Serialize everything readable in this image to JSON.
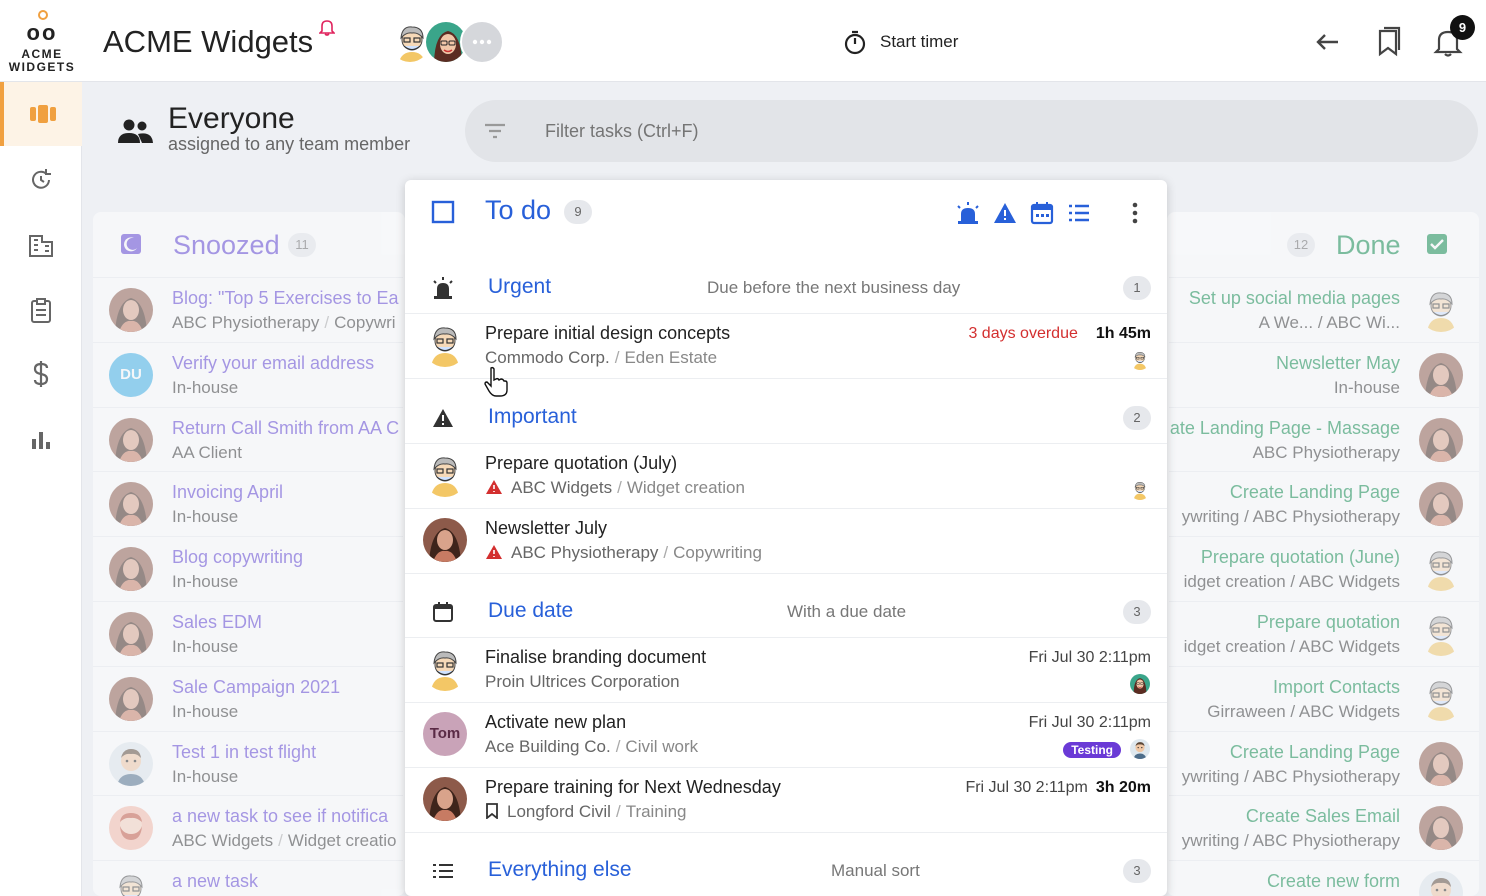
{
  "app": {
    "logo_text": "ACME WIDGETS",
    "title": "ACME Widgets"
  },
  "topbar": {
    "timer_label": "Start timer",
    "notification_count": "9"
  },
  "sidebar": {
    "items": [
      "board",
      "history",
      "clients",
      "tasks",
      "billing",
      "reports"
    ]
  },
  "header": {
    "title": "Everyone",
    "subtitle": "assigned to any team member"
  },
  "filter": {
    "placeholder": "Filter tasks (Ctrl+F)"
  },
  "snoozed": {
    "title": "Snoozed",
    "count": "11",
    "rows": [
      {
        "title": "Blog: \"Top 5 Exercises to Ea",
        "client": "ABC Physiotherapy",
        "project": "Copywri",
        "avatar": "woman-brown"
      },
      {
        "title": "Verify your email address",
        "client": "In-house",
        "project": "",
        "avatar": "DU"
      },
      {
        "title": "Return Call Smith from AA C",
        "client": "AA Client",
        "project": "",
        "avatar": "woman-brown"
      },
      {
        "title": "Invoicing April",
        "client": "In-house",
        "project": "",
        "avatar": "woman-brown"
      },
      {
        "title": "Blog copywriting",
        "client": "In-house",
        "project": "",
        "avatar": "woman-brown"
      },
      {
        "title": "Sales EDM",
        "client": "In-house",
        "project": "",
        "avatar": "woman-brown"
      },
      {
        "title": "Sale Campaign 2021",
        "client": "In-house",
        "project": "",
        "avatar": "woman-brown"
      },
      {
        "title": "Test 1 in test flight",
        "client": "In-house",
        "project": "",
        "avatar": "man-cartoon"
      },
      {
        "title": "a new task to see if notifica",
        "client": "ABC Widgets",
        "project": "Widget creatio",
        "avatar": "man-beard"
      },
      {
        "title": "a new task",
        "client": "",
        "project": "",
        "avatar": "woman-cartoon"
      }
    ]
  },
  "done": {
    "title": "Done",
    "count": "12",
    "rows": [
      {
        "title": "Set up social media pages",
        "sub": "A We...  /  ABC Wi...",
        "avatar": "woman-cartoon"
      },
      {
        "title": "Newsletter May",
        "sub": "In-house",
        "avatar": "woman-brown"
      },
      {
        "title": "ate Landing Page - Massage",
        "sub": "ABC Physiotherapy",
        "avatar": "woman-brown"
      },
      {
        "title": "Create Landing Page",
        "sub": "ywriting  /  ABC Physiotherapy",
        "avatar": "woman-brown"
      },
      {
        "title": "Prepare quotation (June)",
        "sub": "idget creation  /  ABC Widgets",
        "avatar": "woman-cartoon"
      },
      {
        "title": "Prepare quotation",
        "sub": "idget creation  /  ABC Widgets",
        "avatar": "woman-cartoon"
      },
      {
        "title": "Import Contacts",
        "sub": "Girraween  /  ABC Widgets",
        "avatar": "woman-cartoon"
      },
      {
        "title": "Create Landing Page",
        "sub": "ywriting  /  ABC Physiotherapy",
        "avatar": "woman-brown"
      },
      {
        "title": "Create Sales Email",
        "sub": "ywriting  /  ABC Physiotherapy",
        "avatar": "woman-brown"
      },
      {
        "title": "Create new form",
        "sub": "",
        "avatar": "man-cartoon"
      }
    ]
  },
  "todo": {
    "title": "To do",
    "count": "9",
    "sections": {
      "urgent": {
        "name": "Urgent",
        "desc": "Due before the next business day",
        "count": "1"
      },
      "important": {
        "name": "Important",
        "count": "2"
      },
      "due": {
        "name": "Due date",
        "desc": "With a due date",
        "count": "3"
      },
      "else": {
        "name": "Everything else",
        "desc": "Manual sort",
        "count": "3"
      }
    },
    "tasks": [
      {
        "title": "Prepare initial design concepts",
        "client": "Commodo Corp.",
        "project": "Eden Estate",
        "overdue": "3 days overdue",
        "duration": "1h 45m"
      },
      {
        "title": "Prepare quotation (July)",
        "client": "ABC Widgets",
        "project": "Widget creation"
      },
      {
        "title": "Newsletter July",
        "client": "ABC Physiotherapy",
        "project": "Copywriting"
      },
      {
        "title": "Finalise branding document",
        "client": "Proin Ultrices Corporation",
        "due": "Fri Jul 30 2:11pm"
      },
      {
        "title": "Activate new plan",
        "client": "Ace Building Co.",
        "project": "Civil work",
        "due": "Fri Jul 30 2:11pm",
        "tag": "Testing",
        "avatar_text": "Tom"
      },
      {
        "title": "Prepare training for Next Wednesday",
        "client": "Longford Civil",
        "project": "Training",
        "due": "Fri Jul 30 2:11pm",
        "duration": "3h 20m"
      }
    ]
  },
  "colors": {
    "accent": "#2860d9",
    "snoozed": "#5d3fd3",
    "done": "#0a8a4a",
    "overdue": "#d32f2f",
    "active": "#f0a040"
  }
}
